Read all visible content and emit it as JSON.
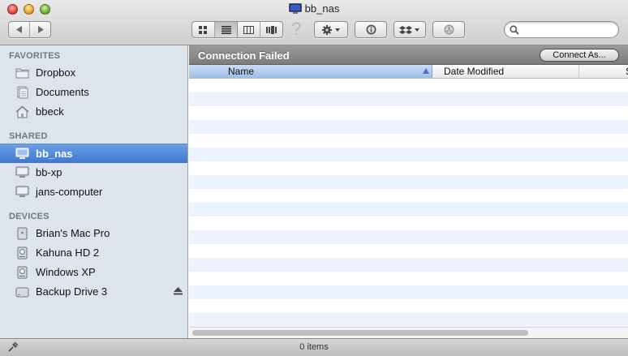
{
  "window": {
    "title": "bb_nas"
  },
  "toolbar": {
    "help_label": "?"
  },
  "search": {
    "placeholder": "",
    "value": ""
  },
  "sidebar": {
    "sections": [
      {
        "title": "FAVORITES",
        "items": [
          {
            "label": "Dropbox",
            "icon": "folder-icon"
          },
          {
            "label": "Documents",
            "icon": "documents-icon"
          },
          {
            "label": "bbeck",
            "icon": "home-icon"
          }
        ]
      },
      {
        "title": "SHARED",
        "items": [
          {
            "label": "bb_nas",
            "icon": "computer-icon",
            "selected": true
          },
          {
            "label": "bb-xp",
            "icon": "computer-icon"
          },
          {
            "label": "jans-computer",
            "icon": "computer-icon"
          }
        ]
      },
      {
        "title": "DEVICES",
        "items": [
          {
            "label": "Brian's Mac Pro",
            "icon": "mac-pro-icon"
          },
          {
            "label": "Kahuna HD 2",
            "icon": "hard-drive-icon"
          },
          {
            "label": "Windows XP",
            "icon": "hard-drive-icon"
          },
          {
            "label": "Backup Drive 3",
            "icon": "external-drive-icon",
            "eject": true
          }
        ]
      }
    ]
  },
  "main": {
    "title": "Connection Failed",
    "connect_button": "Connect As...",
    "columns": {
      "name": "Name",
      "date": "Date Modified",
      "more": "S"
    }
  },
  "status": {
    "text": "0 items"
  },
  "colors": {
    "selection": "#3f77cf",
    "sidebar_bg": "#dde4ec",
    "stripe": "#edf3fe"
  }
}
